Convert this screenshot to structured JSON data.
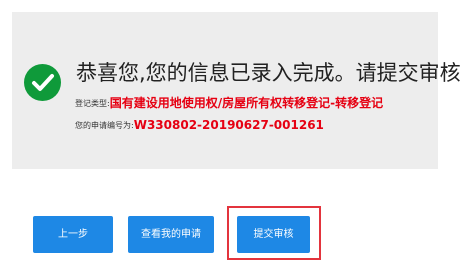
{
  "notice": {
    "headline": "恭喜您,您的信息已录入完成。请提交审核！",
    "type_label": "登记类型:",
    "type_value": "国有建设用地使用权/房屋所有权转移登记-转移登记",
    "number_label": "您的申请编号为:",
    "number_value": "W330802-20190627-001261",
    "success_icon": "check-icon"
  },
  "buttons": {
    "prev_label": "上一步",
    "view_label": "查看我的申请",
    "submit_label": "提交审核"
  },
  "colors": {
    "accent": "#1e88e5",
    "success": "#0f9a3a",
    "highlight": "#e3343d",
    "emphasis": "#e60012"
  }
}
